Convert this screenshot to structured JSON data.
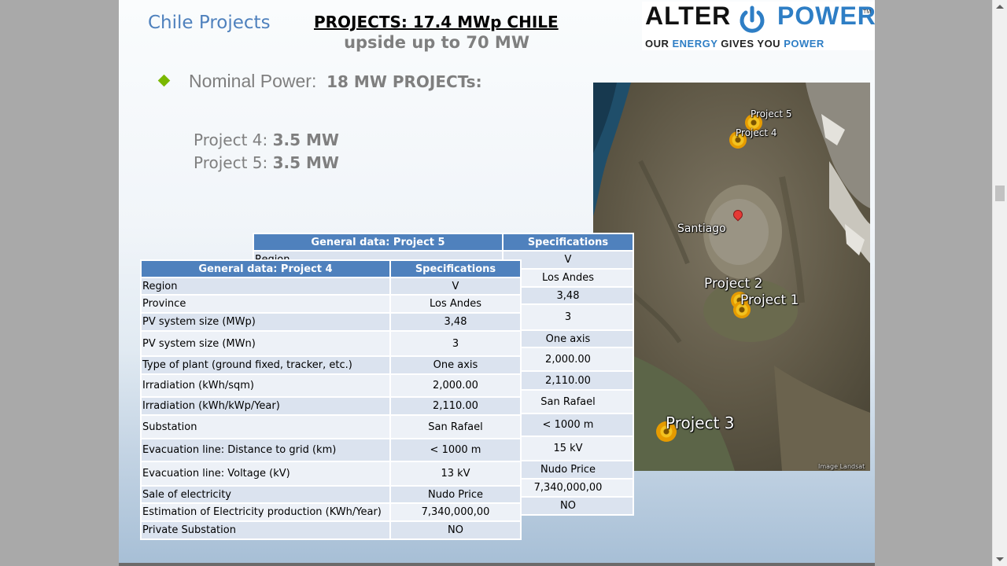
{
  "header": {
    "section_title": "Chile Projects",
    "main_title": "PROJECTS: 17.4 MWp CHILE",
    "subtitle": "upside up to 70 MW"
  },
  "logo": {
    "word_left": "ALTER",
    "word_right": "POWER",
    "trademark": "TM",
    "tagline_a": "OUR ",
    "tagline_b": "ENERGY",
    "tagline_c": " GIVES YOU ",
    "tagline_d": "POWER"
  },
  "bullet": {
    "label": "Nominal Power:",
    "value": "18 MW PROJECTs:"
  },
  "projects": [
    {
      "label": "Project 4:",
      "value": "3.5 MW"
    },
    {
      "label": "Project 5:",
      "value": "3.5 MW"
    }
  ],
  "map": {
    "labels": {
      "p5": "Project 5",
      "p4": "Project 4",
      "santiago": "Santiago",
      "p2": "Project 2",
      "p1": "Project 1",
      "p3": "Project 3",
      "credit": "Image Landsat"
    }
  },
  "table5": {
    "header_left": "General data: Project 5",
    "header_right": "Specifications",
    "partial_label": "Region",
    "values": [
      "V",
      "Los Andes",
      "3,48",
      "3",
      "One axis",
      "2,000.00",
      "2,110.00",
      "San Rafael",
      "< 1000 m",
      "15 kV",
      "Nudo Price",
      "7,340,000,00",
      "NO"
    ]
  },
  "table4": {
    "header_left": "General data: Project 4",
    "header_right": "Specifications",
    "rows": [
      {
        "label": "Region",
        "value": "V"
      },
      {
        "label": "Province",
        "value": "Los Andes"
      },
      {
        "label": "PV system size (MWp)",
        "value": "3,48"
      },
      {
        "label": "PV system size (MWn)",
        "value": "3"
      },
      {
        "label": "Type of plant (ground fixed, tracker, etc.)",
        "value": "One axis"
      },
      {
        "label": "Irradiation (kWh/sqm)",
        "value": "2,000.00"
      },
      {
        "label": "Irradiation (kWh/kWp/Year)",
        "value": "2,110.00"
      },
      {
        "label": "Substation",
        "value": "San Rafael"
      },
      {
        "label": "Evacuation line: Distance to grid (km)",
        "value": "< 1000 m"
      },
      {
        "label": "Evacuation line: Voltage (kV)",
        "value": "13 kV"
      },
      {
        "label": "Sale of electricity",
        "value": "Nudo Price"
      },
      {
        "label": "Estimation of Electricity production (KWh/Year)",
        "value": "7,340,000,00"
      },
      {
        "label": "Private Substation",
        "value": "NO"
      }
    ]
  }
}
